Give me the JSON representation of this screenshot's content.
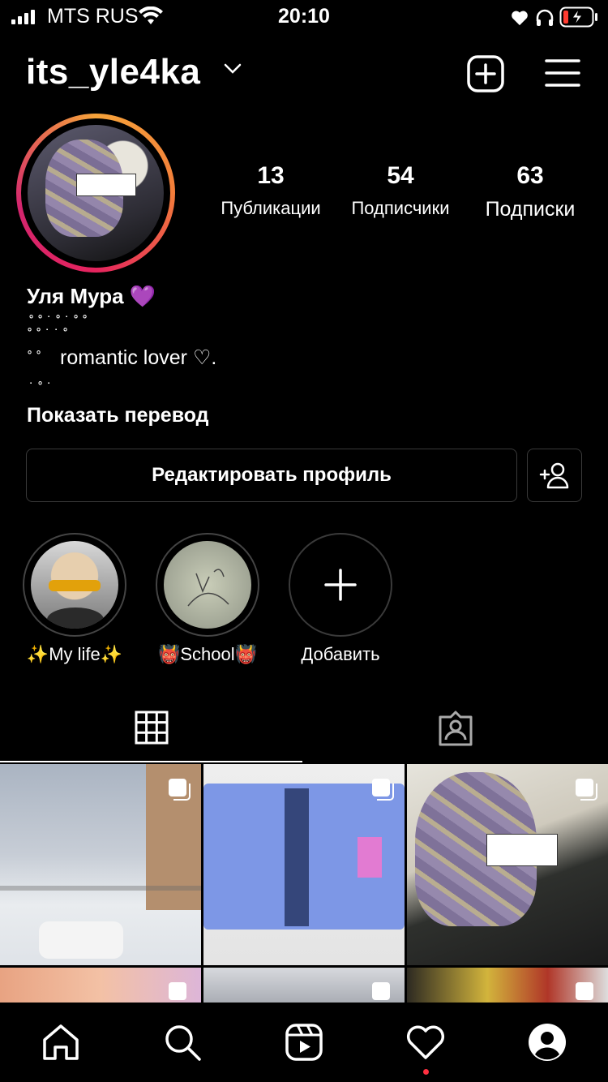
{
  "status_bar": {
    "carrier": "MTS RUS",
    "time": "20:10"
  },
  "header": {
    "username": "its_yle4ka"
  },
  "stats": [
    {
      "count": "13",
      "label": "Публикации"
    },
    {
      "count": "54",
      "label": "Подписчики"
    },
    {
      "count": "63",
      "label": "Подписки"
    }
  ],
  "bio": {
    "full_name": "Уля Мура 💜",
    "line": "romantic lover ♡.",
    "dots_1": "˚ ˚  ˙ ˚ ˙ ˚ ˚",
    "dots_2": "˚    ˚ ˙ ˙    ˚",
    "dots_3": "˚ ˚",
    "dots_4": "˙ ˚ ˙",
    "translate_label": "Показать перевод"
  },
  "buttons": {
    "edit_profile": "Редактировать профиль"
  },
  "highlights": [
    {
      "label": "✨My life✨"
    },
    {
      "label": "👹School👹"
    },
    {
      "label": "Добавить"
    }
  ],
  "tabs": [
    "grid-icon",
    "tagged-icon"
  ],
  "nav": [
    "home-icon",
    "search-icon",
    "reels-icon",
    "activity-icon",
    "profile-icon"
  ],
  "colors": {
    "background": "#000000",
    "accent_ring": "#e5245e",
    "notification_dot": "#ff3040"
  }
}
